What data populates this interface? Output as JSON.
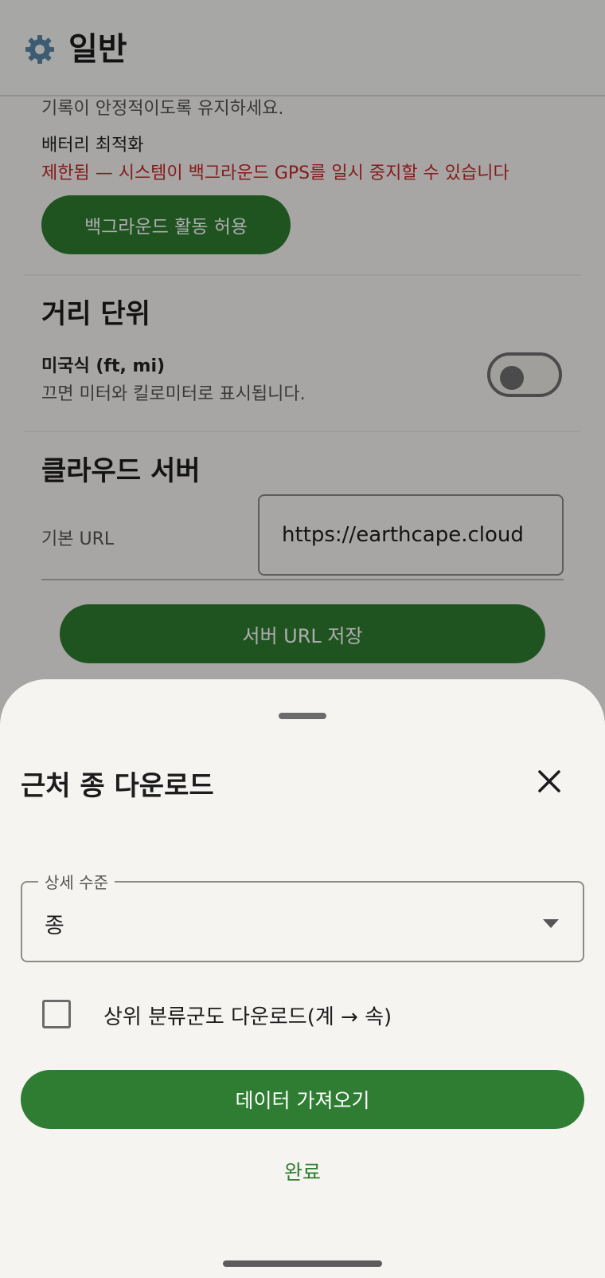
{
  "appbar": {
    "title": "일반",
    "icon": "gear-icon"
  },
  "general": {
    "cut_text": "기록이 안정적이도록 유지하세요.",
    "battery_label": "배터리 최적화",
    "battery_status": "제한됨 — 시스템이 백그라운드 GPS를 일시 중지할 수 있습니다",
    "background_button": "백그라운드 활동 허용"
  },
  "distance": {
    "title": "거리 단위",
    "setting_label": "미국식 (ft, mi)",
    "setting_desc": "끄면 미터와 킬로미터로 표시됩니다.",
    "toggle_on": false
  },
  "cloud": {
    "title": "클라우드 서버",
    "base_url_label": "기본 URL",
    "base_url_value": "https://earthcape.cloud",
    "save_button": "서버 URL 저장"
  },
  "sheet": {
    "title": "근처 종 다운로드",
    "detail_label": "상세 수준",
    "detail_value": "종",
    "checkbox_label": "상위 분류군도 다운로드(계 → 속)",
    "checkbox_checked": false,
    "import_button": "데이터 가져오기",
    "done_button": "완료"
  },
  "colors": {
    "accent": "#2e7d32",
    "warning": "#c62828"
  }
}
